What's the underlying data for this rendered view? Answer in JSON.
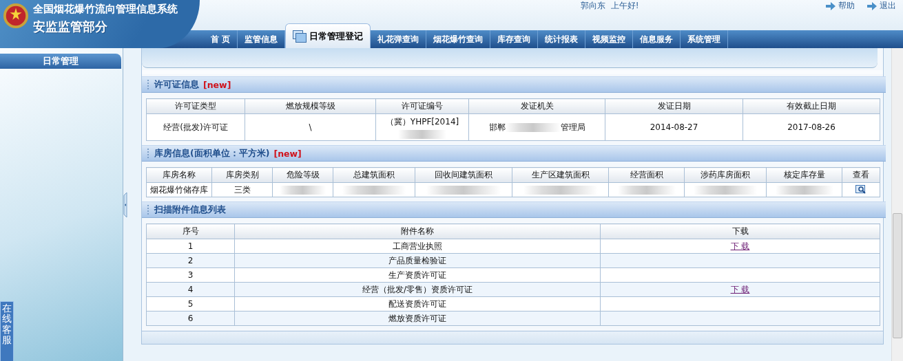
{
  "header": {
    "system_title": "全国烟花爆竹流向管理信息系统",
    "subtitle": "安监监管部分",
    "greeting": "郭向东  上午好!",
    "links": [
      {
        "label": "帮助"
      },
      {
        "label": "退出"
      }
    ]
  },
  "nav_tabs": [
    {
      "label": "首 页",
      "selected": false
    },
    {
      "label": "监管信息",
      "selected": false
    },
    {
      "label": "日常管理登记",
      "selected": true
    },
    {
      "label": "礼花弹查询",
      "selected": false
    },
    {
      "label": "烟花爆竹查询",
      "selected": false
    },
    {
      "label": "库存查询",
      "selected": false
    },
    {
      "label": "统计报表",
      "selected": false
    },
    {
      "label": "视频监控",
      "selected": false
    },
    {
      "label": "信息服务",
      "selected": false
    },
    {
      "label": "系统管理",
      "selected": false
    }
  ],
  "sidebar": {
    "title": "日常管理",
    "service_tab": "在线客服"
  },
  "sections": [
    {
      "kind": "license",
      "title": "许可证信息",
      "badge": "[new]",
      "columns": [
        "许可证类型",
        "燃放规模等级",
        "许可证编号",
        "发证机关",
        "发证日期",
        "有效截止日期"
      ],
      "rows": [
        [
          {
            "kind": "text",
            "text": "经营(批发)许可证"
          },
          {
            "kind": "text",
            "text": "\\"
          },
          {
            "kind": "text_then_redacted",
            "text": "（冀）YHPF[2014]"
          },
          {
            "kind": "redacted_middle",
            "before": "邯郸",
            "after": "管理局"
          },
          {
            "kind": "text",
            "text": "2014-08-27"
          },
          {
            "kind": "text",
            "text": "2017-08-26"
          }
        ]
      ]
    },
    {
      "kind": "warehouse",
      "title": "库房信息(面积单位：平方米)",
      "badge": "[new]",
      "columns": [
        "库房名称",
        "库房类别",
        "危险等级",
        "总建筑面积",
        "回收间建筑面积",
        "生产区建筑面积",
        "经营面积",
        "涉药库房面积",
        "核定库存量",
        "查看"
      ],
      "rows": [
        [
          {
            "kind": "text",
            "text": "烟花爆竹储存库"
          },
          {
            "kind": "text",
            "text": "三类"
          },
          {
            "kind": "redacted"
          },
          {
            "kind": "redacted"
          },
          {
            "kind": "redacted"
          },
          {
            "kind": "redacted"
          },
          {
            "kind": "redacted"
          },
          {
            "kind": "redacted"
          },
          {
            "kind": "redacted"
          },
          {
            "kind": "view"
          }
        ]
      ]
    },
    {
      "kind": "attachments",
      "title": "扫描附件信息列表",
      "columns": [
        "序号",
        "附件名称",
        "下载"
      ],
      "rows": [
        [
          {
            "kind": "text",
            "text": "1"
          },
          {
            "kind": "text",
            "text": "工商营业执照"
          },
          {
            "kind": "link",
            "text": "下 载"
          }
        ],
        [
          {
            "kind": "text",
            "text": "2"
          },
          {
            "kind": "text",
            "text": "产品质量检验证"
          },
          {
            "kind": "empty"
          }
        ],
        [
          {
            "kind": "text",
            "text": "3"
          },
          {
            "kind": "text",
            "text": "生产资质许可证"
          },
          {
            "kind": "empty"
          }
        ],
        [
          {
            "kind": "text",
            "text": "4"
          },
          {
            "kind": "text",
            "text": "经营（批发/零售）资质许可证"
          },
          {
            "kind": "link",
            "text": "下 载"
          }
        ],
        [
          {
            "kind": "text",
            "text": "5"
          },
          {
            "kind": "text",
            "text": "配送资质许可证"
          },
          {
            "kind": "empty"
          }
        ],
        [
          {
            "kind": "text",
            "text": "6"
          },
          {
            "kind": "text",
            "text": "燃放资质许可证"
          },
          {
            "kind": "empty"
          }
        ]
      ]
    }
  ]
}
